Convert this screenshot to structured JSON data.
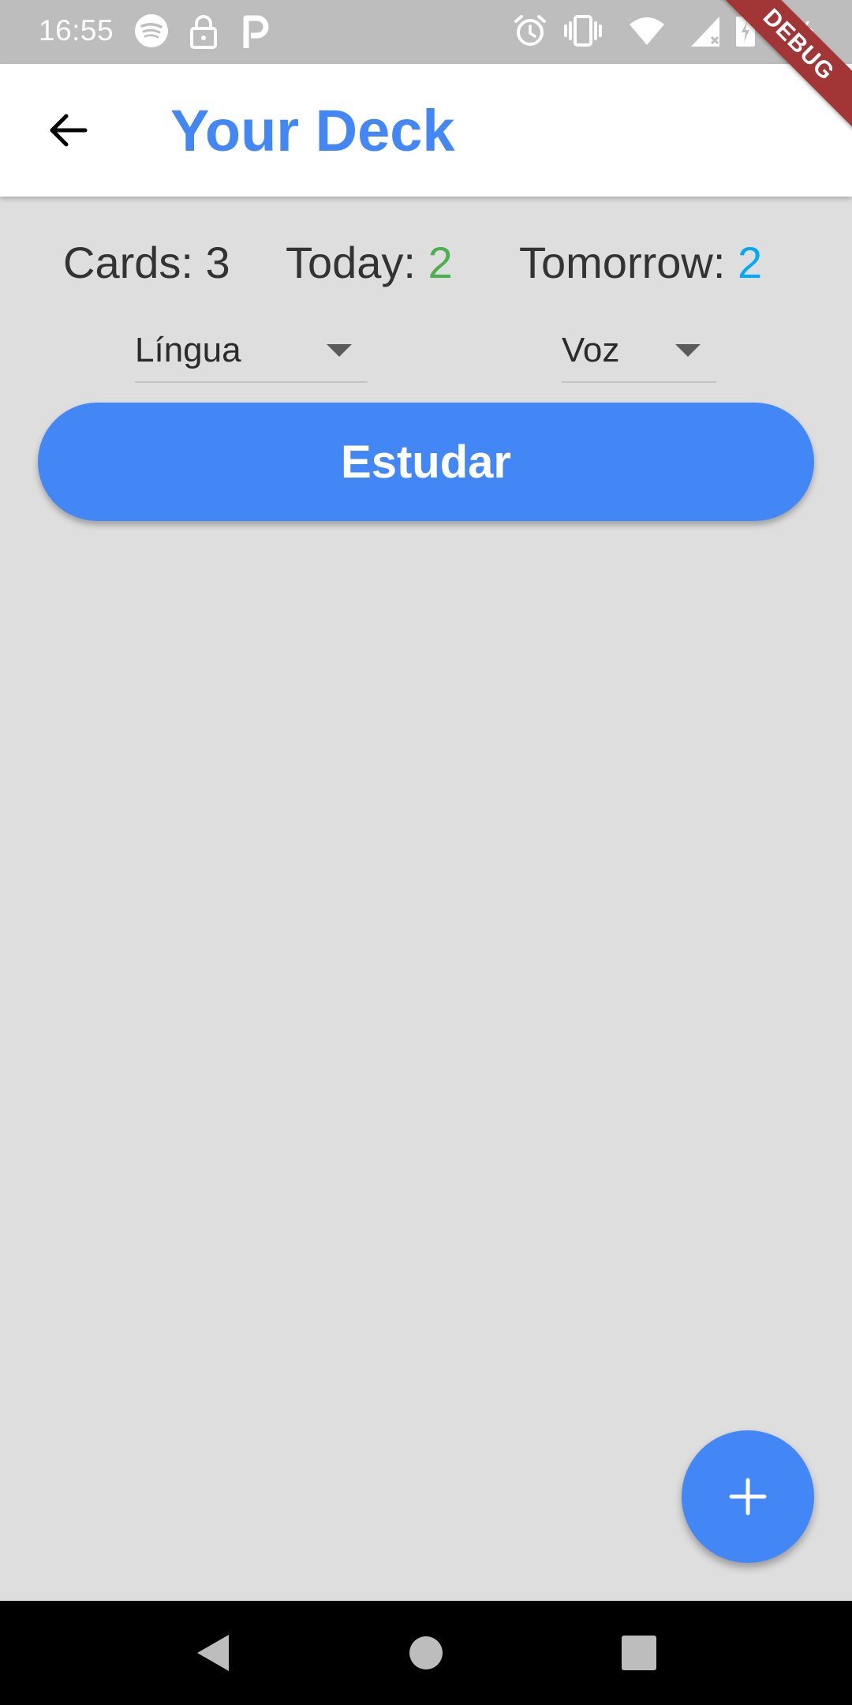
{
  "status_bar": {
    "time": "16:55",
    "battery": "68%",
    "icons": [
      "spotify-icon",
      "lock-icon",
      "p-icon",
      "alarm-icon",
      "vibrate-icon",
      "wifi-icon",
      "signal-icon",
      "battery-icon"
    ]
  },
  "debug_banner": "DEBUG",
  "app_bar": {
    "title": "Your Deck",
    "title_color": "#4287f5"
  },
  "stats": {
    "cards_label": "Cards:",
    "cards_value": "3",
    "today_label": "Today:",
    "today_value": "2",
    "tomorrow_label": "Tomorrow:",
    "tomorrow_value": "2",
    "today_color": "#4caf50",
    "tomorrow_color": "#03a9f4"
  },
  "dropdowns": {
    "language": "Língua",
    "voice": "Voz"
  },
  "study_button": {
    "label": "Estudar",
    "color": "#4287f5"
  },
  "fab": {
    "icon": "plus-icon"
  },
  "nav_bar": {
    "icons": [
      "back-triangle-icon",
      "home-circle-icon",
      "recents-square-icon"
    ]
  }
}
